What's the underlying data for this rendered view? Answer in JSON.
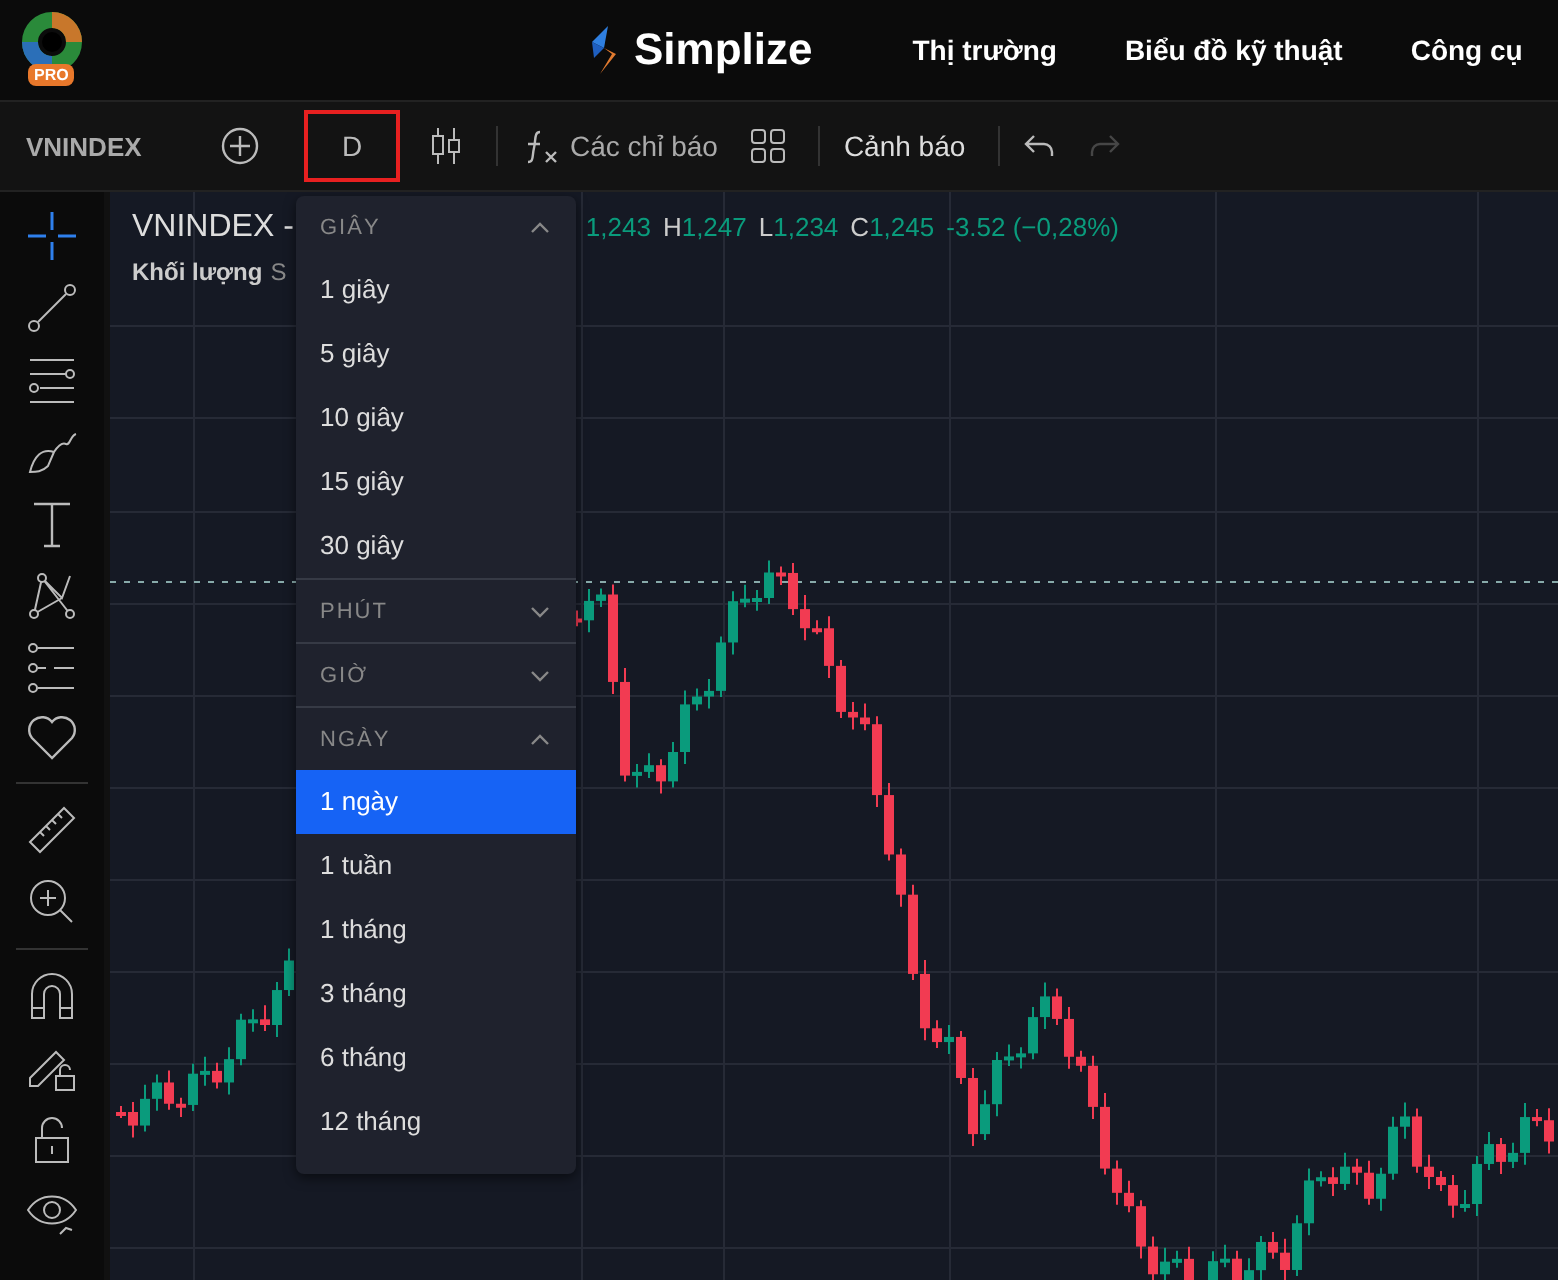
{
  "header": {
    "pro_badge": "PRO",
    "brand": "Simplize",
    "nav": [
      "Thị trường",
      "Biểu đồ kỹ thuật",
      "Công cụ"
    ]
  },
  "toolbar": {
    "symbol": "VNINDEX",
    "interval": "D",
    "indicators": "Các chỉ báo",
    "alert": "Cảnh báo",
    "undo_disabled": false,
    "redo_disabled": true
  },
  "legend": {
    "title": "VNINDEX -",
    "open_tail": "1,243",
    "ohlc": [
      {
        "label": "H",
        "value": "1,247"
      },
      {
        "label": "L",
        "value": "1,234"
      },
      {
        "label": "C",
        "value": "1,245"
      }
    ],
    "change": "-3.52 (−0,28%)",
    "volume_label": "Khối lượng",
    "volume_source": "S"
  },
  "interval_menu": [
    {
      "title": "GIÂY",
      "expanded": true,
      "items": [
        {
          "label": "1 giây",
          "selected": false
        },
        {
          "label": "5 giây",
          "selected": false
        },
        {
          "label": "10 giây",
          "selected": false
        },
        {
          "label": "15 giây",
          "selected": false
        },
        {
          "label": "30 giây",
          "selected": false
        }
      ]
    },
    {
      "title": "PHÚT",
      "expanded": false
    },
    {
      "title": "GIỜ",
      "expanded": false
    },
    {
      "title": "NGÀY",
      "expanded": true,
      "items": [
        {
          "label": "1 ngày",
          "selected": true
        },
        {
          "label": "1 tuần",
          "selected": false
        },
        {
          "label": "1 tháng",
          "selected": false
        },
        {
          "label": "3 tháng",
          "selected": false
        },
        {
          "label": "6 tháng",
          "selected": false
        },
        {
          "label": "12 tháng",
          "selected": false
        }
      ]
    }
  ]
}
